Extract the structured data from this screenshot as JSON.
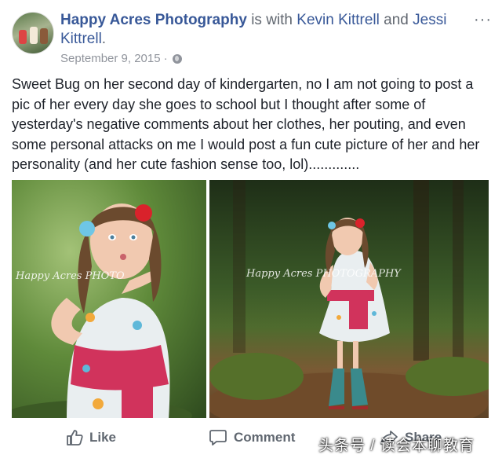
{
  "post": {
    "author": "Happy Acres Photography",
    "is_with": "is with",
    "tag1": "Kevin Kittrell",
    "and": "and",
    "tag2": "Jessi Kittrell",
    "period": ".",
    "date": "September 9, 2015",
    "dot": "·",
    "more": "···",
    "text": "Sweet Bug on her second day of kindergarten, no I am not going to post a pic of her every day she goes to school but I thought after some of yesterday's negative comments about her clothes, her pouting, and even some personal attacks on me I would post a fun cute picture of her and her personality (and her cute fashion sense too, lol).............",
    "photo_watermark_1": "Happy Acres PHOTO",
    "photo_watermark_2": "Happy Acres PHOTOGRAPHY"
  },
  "actions": {
    "like": "Like",
    "comment": "Comment",
    "share": "Share"
  },
  "watermark_overlay": "头条号 / 读会本聊教育",
  "colors": {
    "link": "#385898",
    "text": "#1d2129",
    "meta": "#90949c",
    "action": "#606770"
  }
}
